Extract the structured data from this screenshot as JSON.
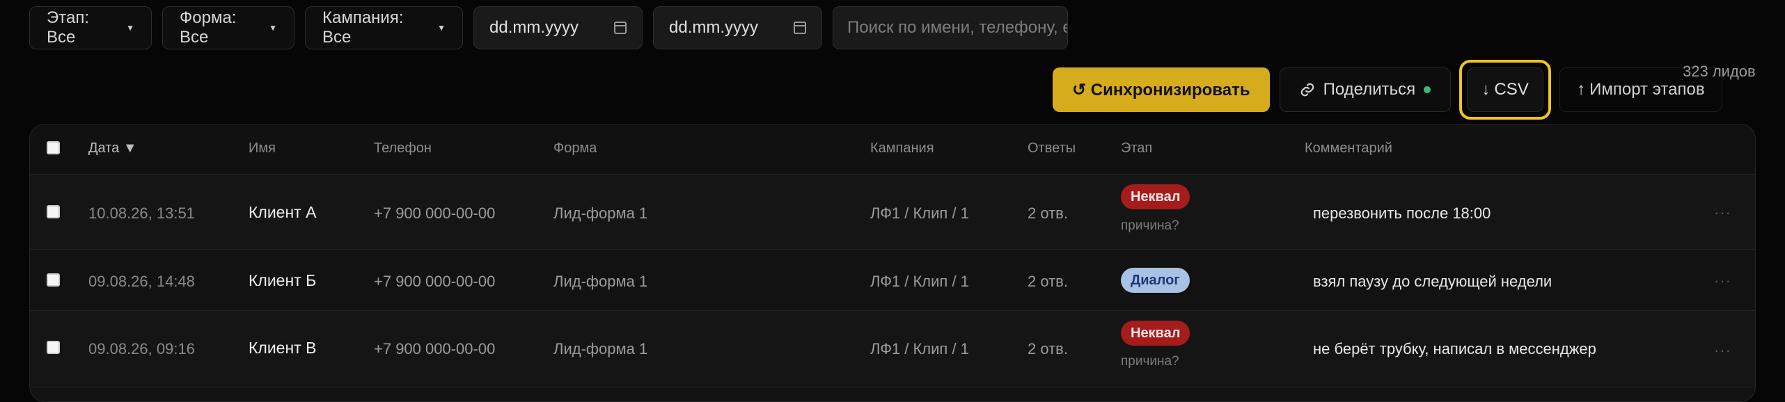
{
  "filters": {
    "stage": "Этап: Все",
    "form": "Форма: Все",
    "campaign": "Кампания: Все",
    "date_from": "dd.mm.yyyy",
    "date_to": "dd.mm.yyyy",
    "search_placeholder": "Поиск по имени, телефону, e"
  },
  "actions": {
    "sync": "↺ Синхронизировать",
    "share": "Поделиться",
    "csv": "CSV",
    "csv_arrow": "↓",
    "import": "Импорт этапов",
    "import_arrow": "↑",
    "lead_count": "323 лидов"
  },
  "colors": {
    "accent": "#d7ac1c",
    "highlight": "#f1c31c",
    "status_online": "#2fbf71"
  },
  "table": {
    "headers": {
      "date": "Дата ▼",
      "name": "Имя",
      "phone": "Телефон",
      "form": "Форма",
      "campaign": "Кампания",
      "answers": "Ответы",
      "stage": "Этап",
      "comment": "Комментарий"
    },
    "rows": [
      {
        "date": "10.08.26, 13:51",
        "name": "Клиент А",
        "phone": "+7 900 000-00-00",
        "form": "Лид-форма 1",
        "campaign": "ЛФ1 / Клип / 1",
        "answers": "2 отв.",
        "stage": "Неквал",
        "reason": "причина?",
        "comment": "перезвонить после 18:00",
        "more": "···"
      },
      {
        "date": "09.08.26, 14:48",
        "name": "Клиент Б",
        "phone": "+7 900 000-00-00",
        "form": "Лид-форма 1",
        "campaign": "ЛФ1 / Клип / 1",
        "answers": "2 отв.",
        "stage": "Диалог",
        "comment": "взял паузу до следующей недели",
        "more": "···"
      },
      {
        "date": "09.08.26, 09:16",
        "name": "Клиент В",
        "phone": "+7 900 000-00-00",
        "form": "Лид-форма 1",
        "campaign": "ЛФ1 / Клип / 1",
        "answers": "2 отв.",
        "stage": "Неквал",
        "reason": "причина?",
        "comment": "не берёт трубку, написал в мессенджер",
        "more": "···"
      }
    ]
  }
}
